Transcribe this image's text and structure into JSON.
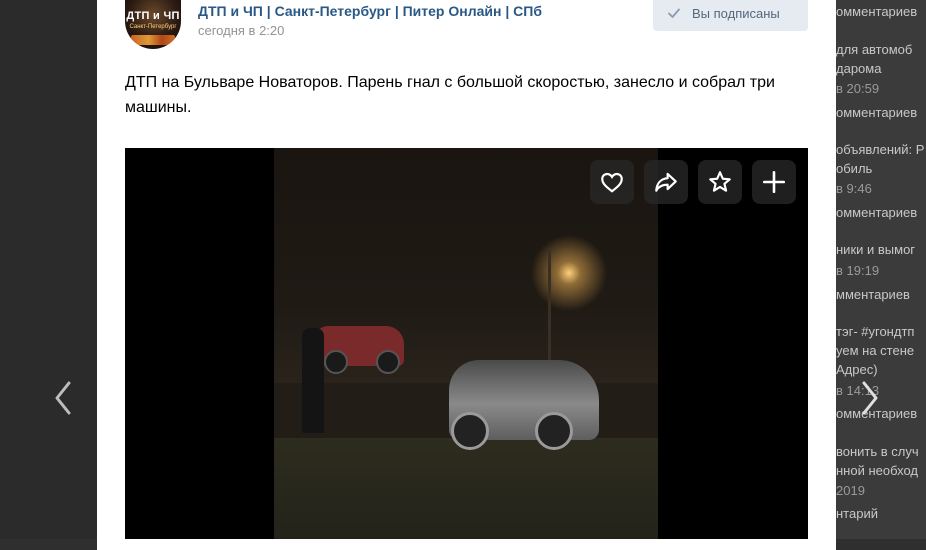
{
  "group": {
    "name": "ДТП и ЧП | Санкт-Петербург | Питер Онлайн | СПб",
    "avatar_text": "ДТП и ЧП",
    "avatar_subtext": "Санкт-Петербург"
  },
  "post": {
    "time": "сегодня в 2:20",
    "text": "ДТП на Бульваре Новаторов. Парень гнал с большой скоростью, занесло и собрал три машины."
  },
  "subscribe_button": {
    "label": "Вы подписаны"
  },
  "video": {
    "actions": [
      {
        "name": "like",
        "icon": "heart-icon"
      },
      {
        "name": "share",
        "icon": "share-icon"
      },
      {
        "name": "favorite",
        "icon": "star-icon"
      },
      {
        "name": "add",
        "icon": "plus-icon"
      }
    ]
  },
  "background_feed": {
    "lines": [
      "омментариев",
      "для автомоб",
      "дарома",
      "в 20:59",
      "омментариев",
      "объявлений: Р",
      "обиль",
      "в 9:46",
      "омментариев",
      "ники и вымог",
      "в 19:19",
      "мментариев",
      "тэг- #угондтп",
      "уем на стене",
      "Адрес)",
      "в 14:13",
      "омментариев",
      "вонить в случ",
      "нной необход",
      "2019",
      "нтарий"
    ]
  },
  "navigation": {
    "prev_icon": "chevron-left-icon",
    "next_icon": "chevron-right-icon"
  }
}
